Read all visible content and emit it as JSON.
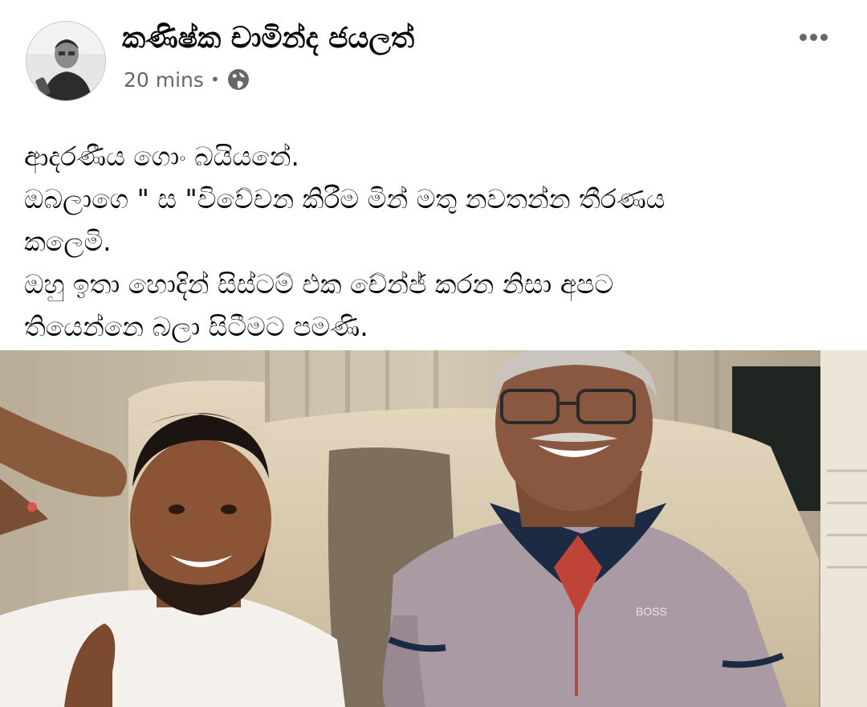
{
  "post": {
    "author_name": "කණිෂ්ක චාමින්ද ජයලත්",
    "timestamp": "20 mins",
    "separator": "•",
    "audience_icon": "globe-icon",
    "more_icon": "more-options-icon",
    "text_lines": [
      "ආදරණීය ගොං බයියනේ.",
      "ඔබලාගෙ \" ස \"විවේචන කිරීම මින් මතු නවතන්න තීරණය",
      "කලෙමි.",
      "ඔහු ඉතා හොදින් සිස්ටම් එක චේන්ජ් කරන නිසා අපට",
      "තියෙන්නෙ බලා සිටීමට පමණි."
    ],
    "photo_brand_text": "BOSS"
  },
  "colors": {
    "text_primary": "#050505",
    "text_secondary": "#65676b",
    "background": "#ffffff"
  }
}
